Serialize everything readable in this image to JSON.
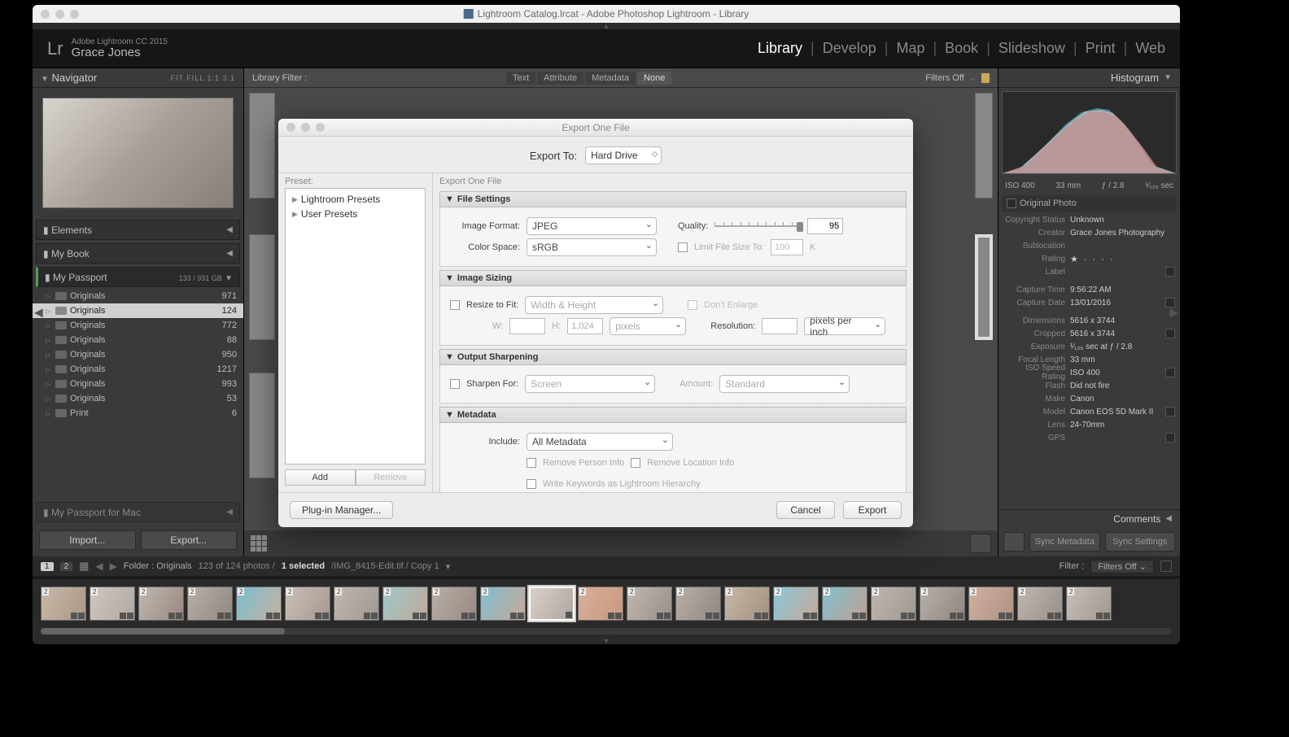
{
  "window": {
    "title": "Lightroom Catalog.lrcat - Adobe Photoshop Lightroom - Library"
  },
  "identity": {
    "logo": "Lr",
    "productLine": "Adobe Lightroom CC 2015",
    "userName": "Grace Jones"
  },
  "modules": [
    "Library",
    "Develop",
    "Map",
    "Book",
    "Slideshow",
    "Print",
    "Web"
  ],
  "activeModule": "Library",
  "leftPanel": {
    "navigatorTitle": "Navigator",
    "navigatorOptions": "FIT   FILL   1:1   3:1",
    "sections": [
      {
        "label": "Elements",
        "active": false
      },
      {
        "label": "My Book",
        "active": false
      },
      {
        "label": "My Passport",
        "active": true,
        "info": "133 / 931 GB"
      }
    ],
    "folders": [
      {
        "name": "Originals",
        "count": 971,
        "sel": false
      },
      {
        "name": "Originals",
        "count": 124,
        "sel": true
      },
      {
        "name": "Originals",
        "count": 772,
        "sel": false
      },
      {
        "name": "Originals",
        "count": 88,
        "sel": false
      },
      {
        "name": "Originals",
        "count": 950,
        "sel": false
      },
      {
        "name": "Originals",
        "count": 1217,
        "sel": false
      },
      {
        "name": "Originals",
        "count": 993,
        "sel": false
      },
      {
        "name": "Originals",
        "count": 53,
        "sel": false
      },
      {
        "name": "Print",
        "count": 6,
        "sel": false
      }
    ],
    "hiddenSection": "My Passport for Mac",
    "importBtn": "Import...",
    "exportBtn": "Export..."
  },
  "libraryFilter": {
    "label": "Library Filter :",
    "tabs": [
      "Text",
      "Attribute",
      "Metadata",
      "None"
    ],
    "activeTab": "None",
    "filtersOff": "Filters Off"
  },
  "rightPanel": {
    "histogramTitle": "Histogram",
    "histInfo": {
      "iso": "ISO 400",
      "focal": "33 mm",
      "aperture": "ƒ / 2.8",
      "shutter": "¹⁄₁₂₅ sec"
    },
    "originalPhoto": "Original Photo",
    "meta": [
      {
        "label": "Copyright Status",
        "val": "Unknown"
      },
      {
        "label": "Creator",
        "val": "Grace Jones Photography"
      },
      {
        "label": "Sublocation",
        "val": ""
      },
      {
        "label": "Rating",
        "val": "★ · · · ·",
        "stars": true
      },
      {
        "label": "Label",
        "val": ""
      },
      {
        "label": "Capture Time",
        "val": "9:56:22 AM"
      },
      {
        "label": "Capture Date",
        "val": "13/01/2016"
      },
      {
        "label": "Dimensions",
        "val": "5616 x 3744"
      },
      {
        "label": "Cropped",
        "val": "5616 x 3744"
      },
      {
        "label": "Exposure",
        "val": "¹⁄₁₂₅ sec at ƒ / 2.8"
      },
      {
        "label": "Focal Length",
        "val": "33 mm"
      },
      {
        "label": "ISO Speed Rating",
        "val": "ISO 400"
      },
      {
        "label": "Flash",
        "val": "Did not fire"
      },
      {
        "label": "Make",
        "val": "Canon"
      },
      {
        "label": "Model",
        "val": "Canon EOS 5D Mark II"
      },
      {
        "label": "Lens",
        "val": "24-70mm"
      },
      {
        "label": "GPS",
        "val": ""
      }
    ],
    "commentsTitle": "Comments",
    "syncMeta": "Sync Metadata",
    "syncSettings": "Sync Settings"
  },
  "exportDialog": {
    "title": "Export One File",
    "exportToLabel": "Export To:",
    "exportToValue": "Hard Drive",
    "presetLabel": "Preset:",
    "presetHeader": "Export One File",
    "presets": [
      "Lightroom Presets",
      "User Presets"
    ],
    "addBtn": "Add",
    "removeBtn": "Remove",
    "sections": {
      "fileSettings": {
        "title": "File Settings",
        "imageFormatLabel": "Image Format:",
        "imageFormatValue": "JPEG",
        "qualityLabel": "Quality:",
        "qualityValue": "95",
        "colorSpaceLabel": "Color Space:",
        "colorSpaceValue": "sRGB",
        "limitLabel": "Limit File Size To:",
        "limitValue": "100",
        "limitUnit": "K"
      },
      "imageSizing": {
        "title": "Image Sizing",
        "resizeLabel": "Resize to Fit:",
        "resizeValue": "Width & Height",
        "dontEnlarge": "Don't Enlarge",
        "wLabel": "W:",
        "hLabel": "H:",
        "hValue": "1,024",
        "unitValue": "pixels",
        "resLabel": "Resolution:",
        "resUnit": "pixels per inch"
      },
      "sharpening": {
        "title": "Output Sharpening",
        "sharpenLabel": "Sharpen For:",
        "sharpenValue": "Screen",
        "amountLabel": "Amount:",
        "amountValue": "Standard"
      },
      "metadata": {
        "title": "Metadata",
        "includeLabel": "Include:",
        "includeValue": "All Metadata",
        "removePerson": "Remove Person Info",
        "removeLocation": "Remove Location Info",
        "writeKeywords": "Write Keywords as Lightroom Hierarchy"
      }
    },
    "pluginBtn": "Plug-in Manager...",
    "cancelBtn": "Cancel",
    "exportBtn": "Export"
  },
  "toolbar": {
    "pathLabel": "Folder : Originals",
    "countText": "123 of 124 photos /",
    "selText": "1 selected",
    "fileText": "/IMG_8415-Edit.tif / Copy 1",
    "filterLabel": "Filter :",
    "filterValue": "Filters Off"
  },
  "thumbBadge": "2"
}
